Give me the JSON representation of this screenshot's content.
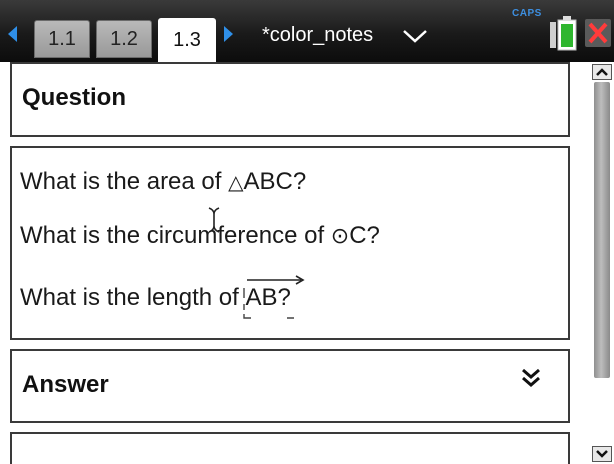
{
  "toolbar": {
    "tabs": [
      {
        "label": "1.1"
      },
      {
        "label": "1.2"
      },
      {
        "label": "1.3"
      }
    ],
    "active_tab": "1.3",
    "document_title": "*color_notes",
    "caps_indicator": "CAPS",
    "icons": {
      "prev": "left-arrow-icon",
      "next": "right-arrow-icon",
      "title_menu": "chevron-down-icon",
      "battery": "battery-icon",
      "close": "close-icon"
    }
  },
  "question": {
    "heading": "Question",
    "lines": [
      {
        "prefix": "What is the area of ",
        "symbol": "△",
        "suffix": "ABC?"
      },
      {
        "prefix": "What is the circumference of ",
        "symbol": "⊙",
        "suffix": "C?"
      },
      {
        "prefix": "What is the length of ",
        "segment": "AB",
        "suffix": "?"
      }
    ]
  },
  "answer": {
    "heading": "Answer",
    "expand_icon": "double-chevron-down-icon"
  },
  "colors": {
    "accent": "#2f8fe8",
    "close": "#e03030",
    "battery": "#40c040",
    "border": "#3a3a3a"
  }
}
